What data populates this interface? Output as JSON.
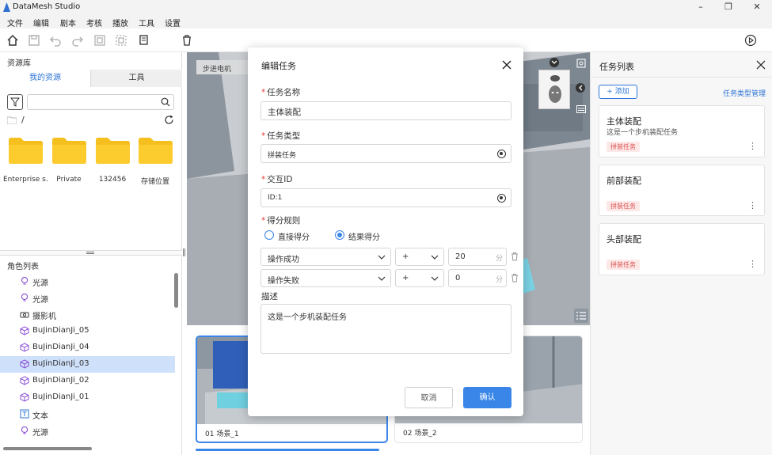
{
  "app": {
    "title": "DataMesh Studio"
  },
  "menu": {
    "items": [
      "文件",
      "编辑",
      "剧本",
      "考核",
      "播放",
      "工具",
      "设置"
    ]
  },
  "left": {
    "resource_title": "资源库",
    "tabs": [
      "我的资源",
      "工具"
    ],
    "path": "/",
    "folders": [
      "Enterprise s…",
      "Private",
      "132456",
      "存储位置"
    ],
    "role_title": "角色列表",
    "roles": [
      {
        "label": "光源",
        "icon": "lightbulb-icon"
      },
      {
        "label": "光源",
        "icon": "lightbulb-icon"
      },
      {
        "label": "摄影机",
        "icon": "camera-icon"
      },
      {
        "label": "BuJinDianJi_05",
        "icon": "cube-icon"
      },
      {
        "label": "BuJinDianJi_04",
        "icon": "cube-icon"
      },
      {
        "label": "BuJinDianJi_03",
        "icon": "cube-icon",
        "selected": true
      },
      {
        "label": "BuJinDianJi_02",
        "icon": "cube-icon"
      },
      {
        "label": "BuJinDianJi_01",
        "icon": "cube-icon"
      },
      {
        "label": "文本",
        "icon": "text-icon"
      },
      {
        "label": "光源",
        "icon": "lightbulb-icon"
      }
    ]
  },
  "viewport": {
    "tag": "步进电机"
  },
  "scenes": [
    {
      "label": "01  场景_1"
    },
    {
      "label": "02  场景_2"
    }
  ],
  "right": {
    "title": "任务列表",
    "add_label": "+ 添加",
    "manage_label": "任务类型管理",
    "tasks": [
      {
        "name": "主体装配",
        "desc": "这是一个步机装配任务",
        "tag": "拼装任务"
      },
      {
        "name": "前部装配",
        "desc": "",
        "tag": "拼装任务"
      },
      {
        "name": "头部装配",
        "desc": "",
        "tag": "拼装任务"
      }
    ]
  },
  "modal": {
    "title": "编辑任务",
    "name_label": "任务名称",
    "name_value": "主体装配",
    "type_label": "任务类型",
    "type_value": "拼装任务",
    "id_label": "交互ID",
    "id_value": "ID:1",
    "score_label": "得分规则",
    "radio_direct": "直接得分",
    "radio_result": "结果得分",
    "rules": [
      {
        "condition": "操作成功",
        "op": "+",
        "score": "20",
        "unit": "分"
      },
      {
        "condition": "操作失败",
        "op": "+",
        "score": "0",
        "unit": "分"
      }
    ],
    "desc_label": "描述",
    "desc_value": "这是一个步机装配任务",
    "cancel": "取消",
    "confirm": "确认"
  },
  "colors": {
    "accent": "#2d74d6",
    "primary_btn": "#3a86e8",
    "folder": "#f5bf1e",
    "selected_row": "#cfe0fb",
    "tag_bg": "#fde8e8",
    "tag_fg": "#d9534f"
  }
}
